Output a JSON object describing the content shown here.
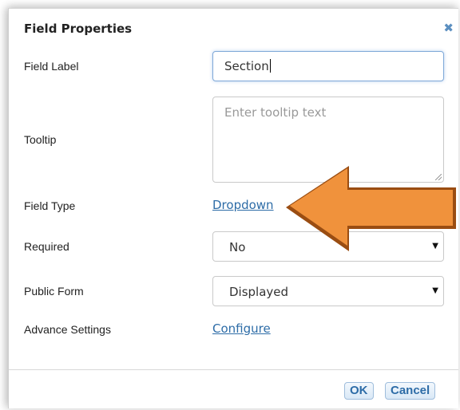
{
  "dialog": {
    "title": "Field Properties",
    "close_glyph": "✖",
    "fields": {
      "field_label": {
        "label": "Field Label",
        "value": "Section"
      },
      "tooltip": {
        "label": "Tooltip",
        "placeholder": "Enter tooltip text"
      },
      "field_type": {
        "label": "Field Type",
        "value": "Dropdown"
      },
      "required": {
        "label": "Required",
        "selected": "No"
      },
      "public_form": {
        "label": "Public Form",
        "selected": "Displayed"
      },
      "advance_settings": {
        "label": "Advance Settings",
        "link": "Configure"
      }
    },
    "buttons": {
      "ok": "OK",
      "cancel": "Cancel"
    }
  },
  "annotation": {
    "arrow_color": "#f0923c",
    "arrow_outline": "#9a4d12",
    "points_to": "field_type"
  },
  "colors": {
    "link": "#2d6ca7",
    "focus_border": "#7fa9d8",
    "button_text": "#2d6ca7"
  }
}
